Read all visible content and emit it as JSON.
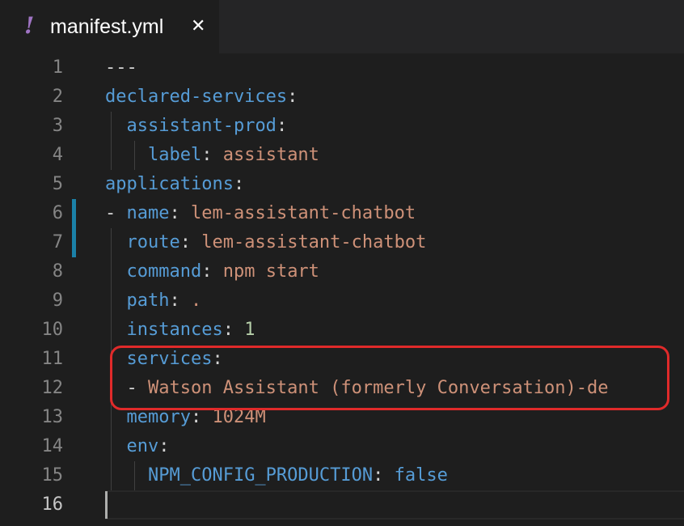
{
  "tab": {
    "icon": "!",
    "title": "manifest.yml",
    "close_label": "✕"
  },
  "lines": [
    {
      "num": "1",
      "tokens": [
        [
          "p",
          "---"
        ]
      ]
    },
    {
      "num": "2",
      "tokens": [
        [
          "k",
          "declared-services"
        ],
        [
          "p",
          ":"
        ]
      ]
    },
    {
      "num": "3",
      "tokens": [
        [
          "p",
          "  "
        ],
        [
          "k",
          "assistant-prod"
        ],
        [
          "p",
          ":"
        ]
      ]
    },
    {
      "num": "4",
      "tokens": [
        [
          "p",
          "    "
        ],
        [
          "k",
          "label"
        ],
        [
          "p",
          ": "
        ],
        [
          "s",
          "assistant"
        ]
      ]
    },
    {
      "num": "5",
      "tokens": [
        [
          "k",
          "applications"
        ],
        [
          "p",
          ":"
        ]
      ]
    },
    {
      "num": "6",
      "tokens": [
        [
          "p",
          "- "
        ],
        [
          "k",
          "name"
        ],
        [
          "p",
          ": "
        ],
        [
          "s",
          "lem-assistant-chatbot"
        ]
      ]
    },
    {
      "num": "7",
      "tokens": [
        [
          "p",
          "  "
        ],
        [
          "k",
          "route"
        ],
        [
          "p",
          ": "
        ],
        [
          "s",
          "lem-assistant-chatbot"
        ]
      ]
    },
    {
      "num": "8",
      "tokens": [
        [
          "p",
          "  "
        ],
        [
          "k",
          "command"
        ],
        [
          "p",
          ": "
        ],
        [
          "s",
          "npm start"
        ]
      ]
    },
    {
      "num": "9",
      "tokens": [
        [
          "p",
          "  "
        ],
        [
          "k",
          "path"
        ],
        [
          "p",
          ": "
        ],
        [
          "s",
          "."
        ]
      ]
    },
    {
      "num": "10",
      "tokens": [
        [
          "p",
          "  "
        ],
        [
          "k",
          "instances"
        ],
        [
          "p",
          ": "
        ],
        [
          "n",
          "1"
        ]
      ]
    },
    {
      "num": "11",
      "tokens": [
        [
          "p",
          "  "
        ],
        [
          "k",
          "services"
        ],
        [
          "p",
          ":"
        ]
      ]
    },
    {
      "num": "12",
      "tokens": [
        [
          "p",
          "  - "
        ],
        [
          "s",
          "Watson Assistant (formerly Conversation)-de"
        ]
      ]
    },
    {
      "num": "13",
      "tokens": [
        [
          "p",
          "  "
        ],
        [
          "k",
          "memory"
        ],
        [
          "p",
          ": "
        ],
        [
          "s",
          "1024M"
        ]
      ]
    },
    {
      "num": "14",
      "tokens": [
        [
          "p",
          "  "
        ],
        [
          "k",
          "env"
        ],
        [
          "p",
          ":"
        ]
      ]
    },
    {
      "num": "15",
      "tokens": [
        [
          "p",
          "    "
        ],
        [
          "k",
          "NPM_CONFIG_PRODUCTION"
        ],
        [
          "p",
          ": "
        ],
        [
          "k",
          "false"
        ]
      ]
    },
    {
      "num": "16",
      "tokens": []
    }
  ],
  "active_line": "16",
  "colors": {
    "key": "#569cd6",
    "string": "#ce9178",
    "number": "#b5cea8",
    "punctuation": "#d4d4d4",
    "highlight_box": "#e02a2a",
    "modified_gutter": "#1b81a8"
  }
}
